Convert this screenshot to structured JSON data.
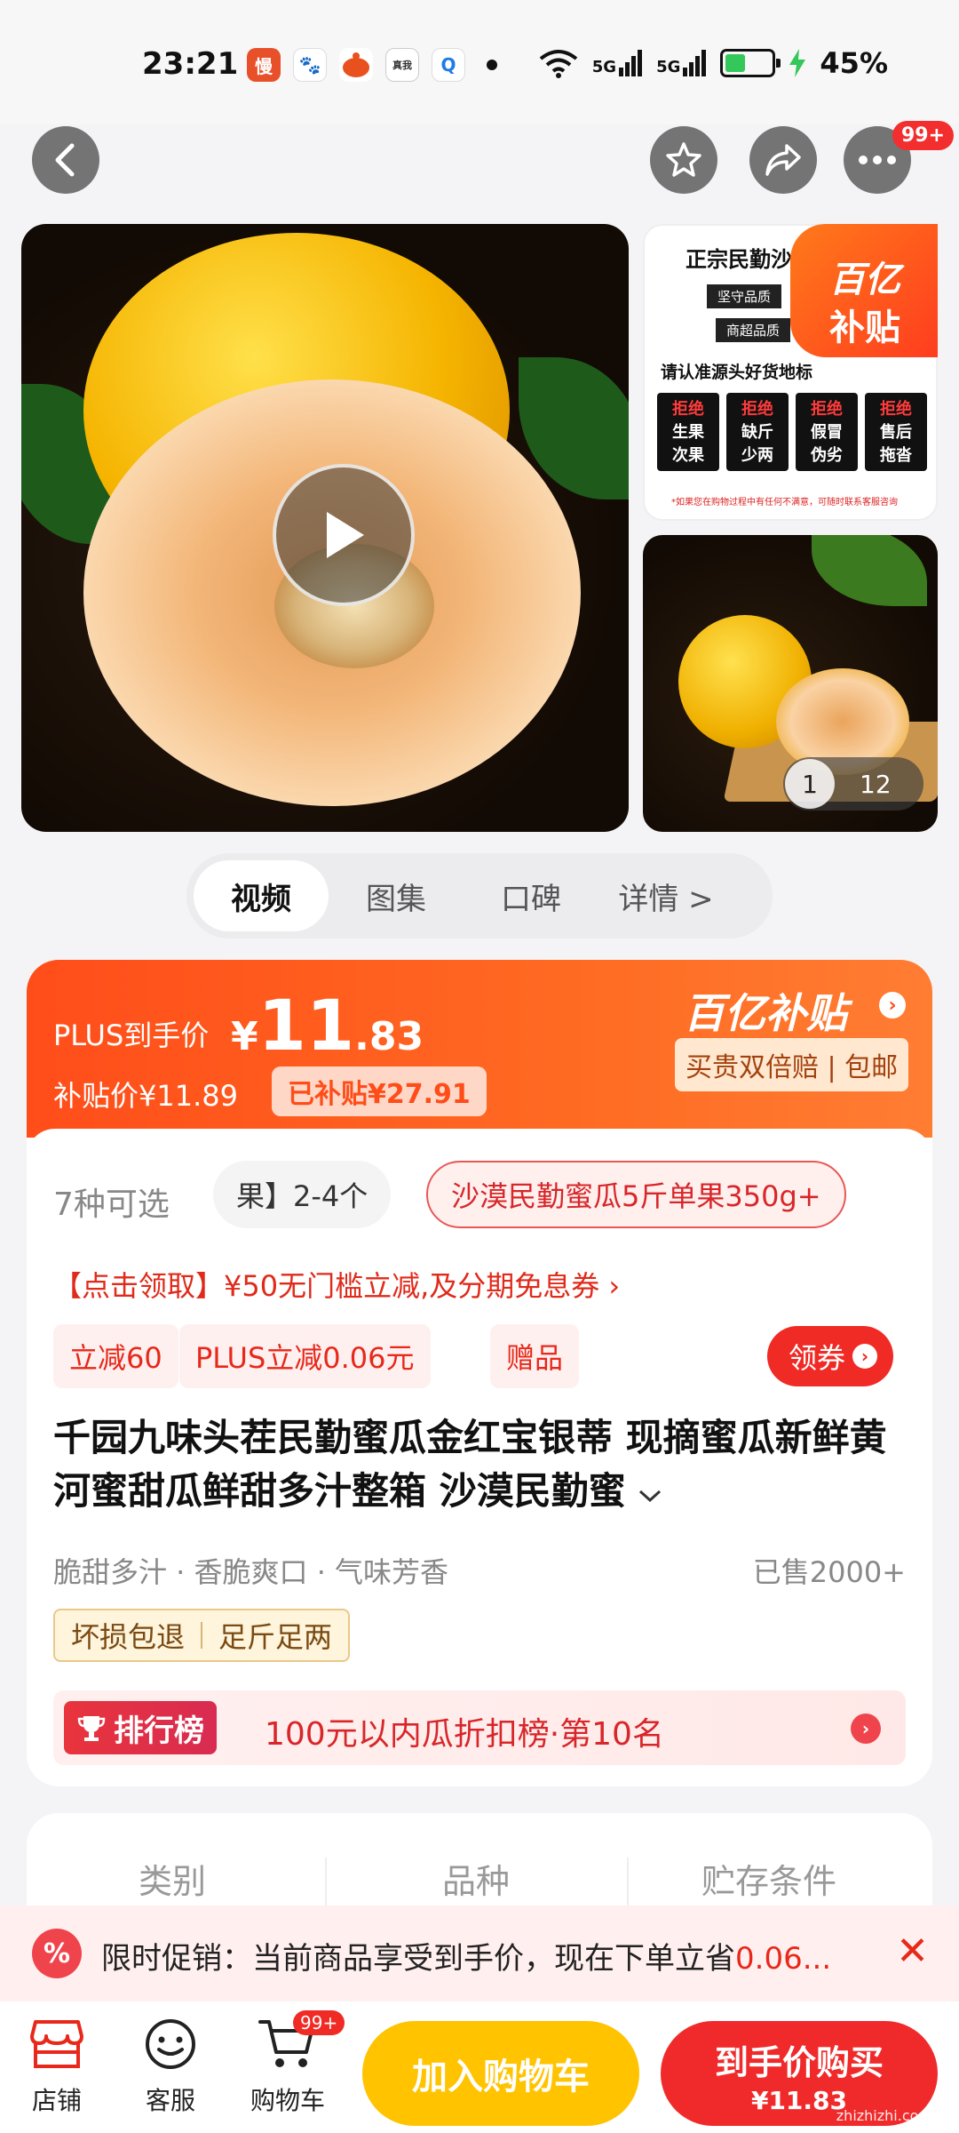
{
  "status_bar": {
    "time": "23:21",
    "battery": "45%",
    "battery_level": 0.45,
    "signal_1": "5G",
    "signal_2": "5G",
    "apps": [
      {
        "icon": "manman-app-icon",
        "glyph": "慢",
        "color": "#e8502a"
      },
      {
        "icon": "baidu-app-icon",
        "glyph": "🐾",
        "color": "#ffffff"
      },
      {
        "icon": "taobao-app-icon",
        "glyph": "●",
        "color": "#f05a1e"
      },
      {
        "icon": "realme-app-icon",
        "glyph": "真我",
        "color": "#ffffff"
      },
      {
        "icon": "search-app-icon",
        "glyph": "Q",
        "color": "#ffffff"
      }
    ]
  },
  "nav": {
    "more_badge": "99+"
  },
  "gallery": {
    "top_card": {
      "title": "正宗民勤沙",
      "tag1": "坚守品质",
      "tag2": "商超品质",
      "line": "请认准源头好货地标",
      "cells": [
        {
          "a": "拒绝",
          "b": "生果",
          "c": "次果"
        },
        {
          "a": "拒绝",
          "b": "缺斤",
          "c": "少两"
        },
        {
          "a": "拒绝",
          "b": "假冒",
          "c": "伪劣"
        },
        {
          "a": "拒绝",
          "b": "售后",
          "c": "拖沓"
        }
      ],
      "footnote": "*如果您在购物过程中有任何不满意，可随时联系客服咨询"
    },
    "subsidy_badge": {
      "l1": "百亿",
      "l2": "补贴"
    },
    "counter_current": "1",
    "counter_total": "12"
  },
  "media_tabs": [
    {
      "label": "视频",
      "active": true
    },
    {
      "label": "图集",
      "active": false
    },
    {
      "label": "口碑",
      "active": false
    },
    {
      "label": "详情 >",
      "active": false
    }
  ],
  "price": {
    "plus_label": "PLUS到手价",
    "currency": "¥",
    "plus_int": "11",
    "plus_dec": ".83",
    "subsidy_price": "补贴价¥11.89",
    "subsidized": "已补贴¥27.91",
    "program_title": "百亿补贴",
    "program_sub": "买贵双倍赔 | 包邮"
  },
  "options": {
    "count": "7种可选",
    "option_a": "果】2-4个",
    "option_b": "沙漠民勤蜜瓜5斤单果350g+"
  },
  "coupon_line": "【点击领取】¥50无门槛立减,及分期免息券 ›",
  "chips": [
    "立减60",
    "PLUS立减0.06元",
    "赠品"
  ],
  "get_coupon": "领券",
  "product": {
    "title": "千园九味头茬民勤蜜瓜金红宝银蒂 现摘蜜瓜新鲜黄河蜜甜瓜鲜甜多汁整箱 沙漠民勤蜜",
    "features": "脆甜多汁 · 香脆爽口 · 气味芳香",
    "sold": "已售2000+",
    "guarantees": [
      "坏损包退",
      "足斤足两"
    ]
  },
  "ranking": {
    "tag": "排行榜",
    "text": "100元以内瓜折扣榜·第10名"
  },
  "specs": [
    "类别",
    "品种",
    "贮存条件"
  ],
  "promo": {
    "icon": "%",
    "text": "限时促销：当前商品享受到手价，现在下单立省",
    "highlight": "0.06..."
  },
  "bottom_bar": {
    "shop": "店铺",
    "service": "客服",
    "cart": "购物车",
    "cart_badge": "99+",
    "add_to_cart": "加入购物车",
    "buy_now": "到手价购买",
    "buy_price": "¥11.83"
  },
  "watermark": "zhizhizhi.com"
}
